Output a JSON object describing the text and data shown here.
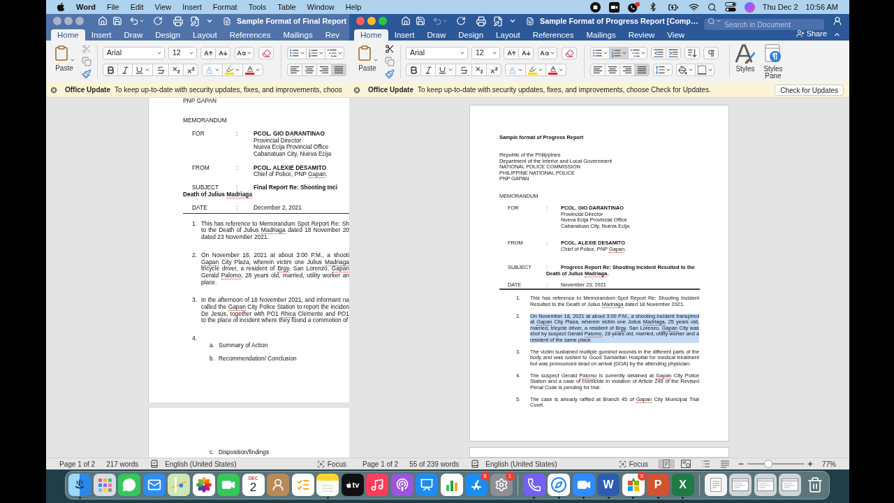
{
  "menu_bar": {
    "app": "Word",
    "menus": [
      "File",
      "Edit",
      "View",
      "Insert",
      "Format",
      "Tools",
      "Table",
      "Window",
      "Help"
    ],
    "date": "Thu Dec 2",
    "time": "10:56 AM"
  },
  "windows": [
    {
      "active": false,
      "title": "Sample Format of Final Report",
      "undo_disabled": false,
      "tabs": [
        {
          "label": "Home",
          "selected": true
        },
        {
          "label": "Insert",
          "selected": false
        },
        {
          "label": "Draw",
          "selected": false
        },
        {
          "label": "Design",
          "selected": false
        },
        {
          "label": "Layout",
          "selected": false
        },
        {
          "label": "References",
          "selected": false
        },
        {
          "label": "Mailings",
          "selected": false
        },
        {
          "label": "Rev",
          "selected": false
        }
      ],
      "ribbon": {
        "paste": "Paste",
        "cut_disabled": true,
        "font": "Arial",
        "size": "12",
        "paragraph_top": [
          {
            "kind": "bullets",
            "selected": false
          },
          {
            "kind": "numbering",
            "selected": false
          },
          {
            "kind": "multilevel",
            "selected": false
          }
        ],
        "paragraph_bottom": [
          {
            "kind": "left",
            "selected": false
          },
          {
            "kind": "center",
            "selected": false
          },
          {
            "kind": "right",
            "selected": false
          },
          {
            "kind": "justify",
            "selected": true
          }
        ]
      },
      "update": {
        "title": "Office Update",
        "message": "To keep up-to-date with security updates, fixes, and improvements, choos"
      },
      "document": {
        "header_lines": [
          "PNP GAPAN"
        ],
        "memo_title": "MEMORANDUM",
        "fields": [
          {
            "kind": "addressee",
            "label": "FOR",
            "colon": ":",
            "name": "PCOL. GIO DARANTINAO",
            "details": [
              {
                "text": "Provincial Director"
              },
              {
                "text": "Nueva Ecija Provincial Office"
              },
              {
                "text": "Cabanatuan City, Nueva Ecija"
              }
            ]
          },
          {
            "kind": "addressee",
            "label": "FROM",
            "colon": ":",
            "name": "PCOL. ALEXIE DESAMITO",
            "details": [
              {
                "runs": [
                  {
                    "text": "Chief of Police, PNP ",
                    "misspelled": false
                  },
                  {
                    "text": "Gapan",
                    "misspelled": true
                  },
                  {
                    "text": ".",
                    "misspelled": false
                  }
                ]
              }
            ]
          },
          {
            "kind": "subject",
            "label": "SUBJECT",
            "colon": ":",
            "text": "Final Report Re: Shooting Inci",
            "continuation": {
              "runs": [
                {
                  "text": "Death of Julius ",
                  "misspelled": false
                },
                {
                  "text": "Madriaga",
                  "misspelled": true
                }
              ]
            }
          },
          {
            "kind": "date",
            "label": "DATE",
            "colon": ":",
            "value": "December 2, 2021"
          }
        ],
        "items": [
          {
            "number": "1.",
            "selected": false,
            "lines": [
              {
                "text": "This has reference to Memorandum Spot Report Re: Sh"
              },
              {
                "runs": [
                  {
                    "text": "to the Death of Julius ",
                    "misspelled": false
                  },
                  {
                    "text": "Madriaga",
                    "misspelled": true
                  },
                  {
                    "text": " dated 18 November 20",
                    "misspelled": false
                  }
                ]
              },
              {
                "text": "dated 23 November 2021."
              }
            ]
          },
          {
            "number": "2.",
            "selected": false,
            "lines": [
              {
                "text": "On November 18, 2021 at about 3:00 P.M., a shooti"
              },
              {
                "runs": [
                  {
                    "text": "Gapan",
                    "misspelled": true
                  },
                  {
                    "text": " City Plaza, wherein victim one Julius ",
                    "misspelled": false
                  },
                  {
                    "text": "Madriaga",
                    "misspelled": true
                  }
                ]
              },
              {
                "runs": [
                  {
                    "text": "tricycle driver, a resident of ",
                    "misspelled": false
                  },
                  {
                    "text": "Brgy",
                    "misspelled": true
                  },
                  {
                    "text": ". San Lorenzo, ",
                    "misspelled": false
                  },
                  {
                    "text": "Gapan",
                    "misspelled": true
                  }
                ]
              },
              {
                "runs": [
                  {
                    "text": "Gerald ",
                    "misspelled": false
                  },
                  {
                    "text": "Palomo",
                    "misspelled": true
                  },
                  {
                    "text": ", 28 years old, married, utility worker an",
                    "misspelled": false
                  }
                ]
              },
              {
                "text": "place."
              }
            ]
          },
          {
            "number": "3.",
            "selected": false,
            "lines": [
              {
                "text": "In the afternoon of 18 November 2021, and informant na"
              },
              {
                "runs": [
                  {
                    "text": "called the ",
                    "misspelled": false
                  },
                  {
                    "text": "Gapan",
                    "misspelled": true
                  },
                  {
                    "text": " City Police Station to report the inciden",
                    "misspelled": false
                  }
                ]
              },
              {
                "runs": [
                  {
                    "text": "De Jesus, together with PO1 ",
                    "misspelled": false
                  },
                  {
                    "text": "Rhica",
                    "misspelled": true
                  },
                  {
                    "text": " Clemente and PO1",
                    "misspelled": false
                  }
                ]
              },
              {
                "text": "to the place of incident where they found a commotion of"
              }
            ]
          },
          {
            "number": "4.",
            "selected": false,
            "subitems": [
              {
                "letter": "a.",
                "text": "Summary of Action"
              },
              {
                "letter": "b.",
                "text": "Recommendation/ Conclusion"
              }
            ]
          }
        ],
        "next_page": [
          {
            "letter": "c.",
            "text": "Disposition/findings"
          }
        ]
      },
      "status": {
        "page": "Page 1 of 2",
        "words": "217 words",
        "language": "English (United States)",
        "focus": "Focus"
      }
    },
    {
      "active": true,
      "title": "Sample Format of Progress Report [Comp…",
      "undo_disabled": true,
      "search": {
        "placeholder": "Search in Document"
      },
      "share": "Share",
      "tabs": [
        {
          "label": "Home",
          "selected": true
        },
        {
          "label": "Insert",
          "selected": false
        },
        {
          "label": "Draw",
          "selected": false
        },
        {
          "label": "Design",
          "selected": false
        },
        {
          "label": "Layout",
          "selected": false
        },
        {
          "label": "References",
          "selected": false
        },
        {
          "label": "Mailings",
          "selected": false
        },
        {
          "label": "Review",
          "selected": false
        },
        {
          "label": "View",
          "selected": false
        }
      ],
      "ribbon": {
        "paste": "Paste",
        "cut_disabled": false,
        "font": "Arial",
        "size": "12",
        "paragraph_top": [
          {
            "kind": "bullets",
            "selected": false
          },
          {
            "kind": "numbering",
            "selected": true
          },
          {
            "kind": "multilevel",
            "selected": false
          },
          {
            "kind": "outdent",
            "selected": false
          },
          {
            "kind": "indent",
            "selected": false
          },
          {
            "kind": "sort",
            "selected": false
          },
          {
            "kind": "pilcrow",
            "selected": false
          }
        ],
        "paragraph_bottom": [
          {
            "kind": "left",
            "selected": false
          },
          {
            "kind": "center",
            "selected": false
          },
          {
            "kind": "right",
            "selected": false
          },
          {
            "kind": "justify",
            "selected": true
          },
          {
            "kind": "spacing",
            "selected": false
          },
          {
            "kind": "shading",
            "selected": false
          },
          {
            "kind": "borders",
            "selected": false
          }
        ],
        "styles": [
          {
            "kind": "gallery",
            "label": "Styles"
          },
          {
            "kind": "pane",
            "label": "Styles Pane"
          }
        ]
      },
      "update": {
        "title": "Office Update",
        "message": "To keep up-to-date with security updates, fixes, and improvements, choose Check for Updates.",
        "button": "Check for Updates"
      },
      "document": {
        "heading": "Sample format of Progress Report",
        "header_lines": [
          "Republic of the Philippines",
          "Department of the Interior and Local Government",
          "NATIONAL POLICE COMMISSION",
          "PHILIPPINE NATIONAL POLICE",
          "PNP GAPAN"
        ],
        "memo_title": "MEMORANDUM",
        "fields": [
          {
            "kind": "addressee",
            "label": "FOR",
            "colon": ":",
            "name": "PCOL. GIO DARANTINAO",
            "details": [
              {
                "text": "Provincial Director"
              },
              {
                "text": "Nueva Ecija Provincial Office"
              },
              {
                "text": "Cabanatuan City, Nueva Ecija"
              }
            ]
          },
          {
            "kind": "addressee",
            "label": "FROM",
            "colon": ":",
            "name": "PCOL. ALEXIE DESAMITO",
            "details": [
              {
                "runs": [
                  {
                    "text": "Chief of Police, PNP ",
                    "misspelled": false
                  },
                  {
                    "text": "Gapan",
                    "misspelled": true
                  },
                  {
                    "text": ".",
                    "misspelled": false
                  }
                ]
              }
            ]
          },
          {
            "kind": "hanging",
            "label": "SUBJECT",
            "colon": ":",
            "text": "Progress Report Re: Shooting Incident Resulted to the",
            "continuation": {
              "runs": [
                {
                  "text": "Death of Julius ",
                  "misspelled": false
                },
                {
                  "text": "Madriaga",
                  "misspelled": true
                },
                {
                  "text": ".",
                  "misspelled": false
                }
              ]
            }
          },
          {
            "kind": "date",
            "label": "DATE",
            "colon": ":",
            "value": "November 23, 2021"
          }
        ],
        "items": [
          {
            "number": "1.",
            "selected": false,
            "runs": [
              {
                "text": "This has reference to Memorandum Spot Report Re: Shooting Incident Resulted to the Death of Julius ",
                "misspelled": false
              },
              {
                "text": "Madriaga",
                "misspelled": true
              },
              {
                "text": " dated 18 November 2021.",
                "misspelled": false
              }
            ]
          },
          {
            "number": "2.",
            "selected": true,
            "runs": [
              {
                "text": "On November 18, 2021 at about 3:00 P.M., a shooting incident transpired at ",
                "misspelled": false
              },
              {
                "text": "Gapan",
                "misspelled": true
              },
              {
                "text": " City Plaza, wherein victim one Julius ",
                "misspelled": false
              },
              {
                "text": "Madriaga",
                "misspelled": true
              },
              {
                "text": ", 25 years old, married, tricycle driver, a resident of ",
                "misspelled": false
              },
              {
                "text": "Brgy",
                "misspelled": true
              },
              {
                "text": ". San Lorenzo, ",
                "misspelled": false
              },
              {
                "text": "Gapan",
                "misspelled": true
              },
              {
                "text": " City was shot by suspect Gerald ",
                "misspelled": false
              },
              {
                "text": "Palomo",
                "misspelled": true
              },
              {
                "text": ", 28 years old, married, utility worker and a resident of the same place.",
                "misspelled": false
              }
            ]
          },
          {
            "number": "3.",
            "selected": false,
            "text": "The victim sustained multiple gunshot wounds in the different parts of the body and was rushed to Good Samaritan Hospital for medical treatment but was pronounced dead on arrival (DOA) by the attending physician."
          },
          {
            "number": "4.",
            "selected": false,
            "runs": [
              {
                "text": "The suspect Gerald ",
                "misspelled": false
              },
              {
                "text": "Palomo",
                "misspelled": true
              },
              {
                "text": " is currently detained at ",
                "misspelled": false
              },
              {
                "text": "Gapan",
                "misspelled": true
              },
              {
                "text": " City Police Station and a case of Homicide in violation of Article 249 of the Revised Penal Code is pending for trial.",
                "misspelled": false
              }
            ]
          },
          {
            "number": "5.",
            "selected": false,
            "runs": [
              {
                "text": "The case is already raffled at Branch 45 of ",
                "misspelled": false
              },
              {
                "text": "Gapan",
                "misspelled": true
              },
              {
                "text": " City Municipal Trial Court.",
                "misspelled": false
              }
            ]
          }
        ]
      },
      "status": {
        "page": "Page 1 of 2",
        "words": "55 of 239 words",
        "language": "English (United States)",
        "focus": "Focus",
        "views": [
          {
            "kind": "print",
            "selected": true
          },
          {
            "kind": "web",
            "selected": false
          },
          {
            "kind": "outline",
            "selected": false
          },
          {
            "kind": "draft",
            "selected": false
          }
        ],
        "zoom": {
          "level": 0.37,
          "reading": "77%"
        }
      }
    }
  ],
  "dock": {
    "sections": [
      {
        "items": [
          {
            "kind": "finder",
            "running": true
          },
          {
            "kind": "launchpad",
            "running": false
          },
          {
            "kind": "messages",
            "running": false
          },
          {
            "kind": "mail",
            "running": false
          },
          {
            "kind": "maps",
            "running": false
          },
          {
            "kind": "photos",
            "running": false
          },
          {
            "kind": "facetime",
            "running": false
          },
          {
            "kind": "calendar",
            "running": false,
            "month": "DEC",
            "day": "2"
          },
          {
            "kind": "contacts",
            "running": false
          },
          {
            "kind": "reminders",
            "running": false
          },
          {
            "kind": "notes",
            "running": true
          },
          {
            "kind": "tv",
            "running": false,
            "label": "tv"
          },
          {
            "kind": "music",
            "running": false
          },
          {
            "kind": "podcasts",
            "running": false
          },
          {
            "kind": "keynote",
            "running": false
          },
          {
            "kind": "numbers",
            "running": false
          },
          {
            "kind": "appstore",
            "running": false,
            "badge": "5"
          },
          {
            "kind": "settings",
            "running": false,
            "badge": "1"
          }
        ]
      },
      {
        "items": [
          {
            "kind": "viber",
            "running": true
          },
          {
            "kind": "safari",
            "running": true
          },
          {
            "kind": "zoom",
            "running": true
          },
          {
            "kind": "word",
            "running": true,
            "label": "W"
          },
          {
            "kind": "office",
            "running": true,
            "badge": "5"
          },
          {
            "kind": "powerpoint",
            "running": true,
            "label": "P"
          },
          {
            "kind": "excel",
            "running": true,
            "label": "X"
          }
        ]
      },
      {
        "items": [
          {
            "kind": "document",
            "running": false
          },
          {
            "kind": "window",
            "running": false
          },
          {
            "kind": "window",
            "running": false
          },
          {
            "kind": "window",
            "running": false
          },
          {
            "kind": "trash",
            "running": false
          }
        ]
      }
    ]
  }
}
